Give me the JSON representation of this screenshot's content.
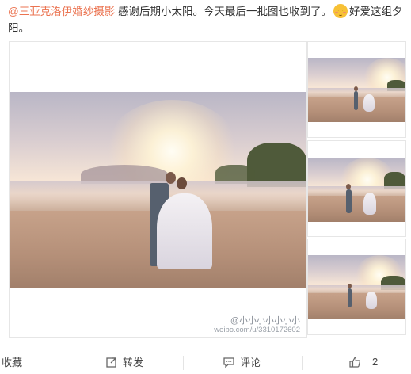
{
  "post": {
    "mention": "@三亚克洛伊婚纱摄影",
    "text_main": " 感谢后期小太阳。今天最后一批图也收到了。",
    "emoji_icon": "blushing-smile-emoji",
    "text_tail": "好爱这组夕阳。"
  },
  "photos": {
    "watermark_line1": "@小小小小小小小",
    "watermark_line2": "weibo.com/u/3310172602"
  },
  "actions": {
    "favorite_label": "收藏",
    "repost_label": "转发",
    "comment_label": "评论",
    "like_count": "2"
  },
  "icons": {
    "repost": "repost-icon",
    "comment": "comment-icon",
    "like": "thumbs-up-icon"
  },
  "colors": {
    "mention": "#eb7350",
    "text": "#333333",
    "watermark": "#9aa0a8"
  }
}
